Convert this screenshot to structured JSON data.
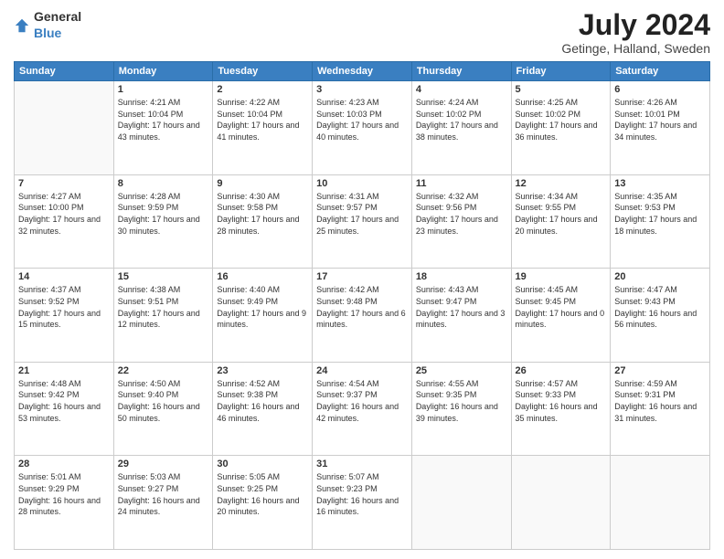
{
  "header": {
    "logo_general": "General",
    "logo_blue": "Blue",
    "month": "July 2024",
    "location": "Getinge, Halland, Sweden"
  },
  "days_of_week": [
    "Sunday",
    "Monday",
    "Tuesday",
    "Wednesday",
    "Thursday",
    "Friday",
    "Saturday"
  ],
  "weeks": [
    [
      {
        "day": "",
        "sunrise": "",
        "sunset": "",
        "daylight": ""
      },
      {
        "day": "1",
        "sunrise": "Sunrise: 4:21 AM",
        "sunset": "Sunset: 10:04 PM",
        "daylight": "Daylight: 17 hours and 43 minutes."
      },
      {
        "day": "2",
        "sunrise": "Sunrise: 4:22 AM",
        "sunset": "Sunset: 10:04 PM",
        "daylight": "Daylight: 17 hours and 41 minutes."
      },
      {
        "day": "3",
        "sunrise": "Sunrise: 4:23 AM",
        "sunset": "Sunset: 10:03 PM",
        "daylight": "Daylight: 17 hours and 40 minutes."
      },
      {
        "day": "4",
        "sunrise": "Sunrise: 4:24 AM",
        "sunset": "Sunset: 10:02 PM",
        "daylight": "Daylight: 17 hours and 38 minutes."
      },
      {
        "day": "5",
        "sunrise": "Sunrise: 4:25 AM",
        "sunset": "Sunset: 10:02 PM",
        "daylight": "Daylight: 17 hours and 36 minutes."
      },
      {
        "day": "6",
        "sunrise": "Sunrise: 4:26 AM",
        "sunset": "Sunset: 10:01 PM",
        "daylight": "Daylight: 17 hours and 34 minutes."
      }
    ],
    [
      {
        "day": "7",
        "sunrise": "Sunrise: 4:27 AM",
        "sunset": "Sunset: 10:00 PM",
        "daylight": "Daylight: 17 hours and 32 minutes."
      },
      {
        "day": "8",
        "sunrise": "Sunrise: 4:28 AM",
        "sunset": "Sunset: 9:59 PM",
        "daylight": "Daylight: 17 hours and 30 minutes."
      },
      {
        "day": "9",
        "sunrise": "Sunrise: 4:30 AM",
        "sunset": "Sunset: 9:58 PM",
        "daylight": "Daylight: 17 hours and 28 minutes."
      },
      {
        "day": "10",
        "sunrise": "Sunrise: 4:31 AM",
        "sunset": "Sunset: 9:57 PM",
        "daylight": "Daylight: 17 hours and 25 minutes."
      },
      {
        "day": "11",
        "sunrise": "Sunrise: 4:32 AM",
        "sunset": "Sunset: 9:56 PM",
        "daylight": "Daylight: 17 hours and 23 minutes."
      },
      {
        "day": "12",
        "sunrise": "Sunrise: 4:34 AM",
        "sunset": "Sunset: 9:55 PM",
        "daylight": "Daylight: 17 hours and 20 minutes."
      },
      {
        "day": "13",
        "sunrise": "Sunrise: 4:35 AM",
        "sunset": "Sunset: 9:53 PM",
        "daylight": "Daylight: 17 hours and 18 minutes."
      }
    ],
    [
      {
        "day": "14",
        "sunrise": "Sunrise: 4:37 AM",
        "sunset": "Sunset: 9:52 PM",
        "daylight": "Daylight: 17 hours and 15 minutes."
      },
      {
        "day": "15",
        "sunrise": "Sunrise: 4:38 AM",
        "sunset": "Sunset: 9:51 PM",
        "daylight": "Daylight: 17 hours and 12 minutes."
      },
      {
        "day": "16",
        "sunrise": "Sunrise: 4:40 AM",
        "sunset": "Sunset: 9:49 PM",
        "daylight": "Daylight: 17 hours and 9 minutes."
      },
      {
        "day": "17",
        "sunrise": "Sunrise: 4:42 AM",
        "sunset": "Sunset: 9:48 PM",
        "daylight": "Daylight: 17 hours and 6 minutes."
      },
      {
        "day": "18",
        "sunrise": "Sunrise: 4:43 AM",
        "sunset": "Sunset: 9:47 PM",
        "daylight": "Daylight: 17 hours and 3 minutes."
      },
      {
        "day": "19",
        "sunrise": "Sunrise: 4:45 AM",
        "sunset": "Sunset: 9:45 PM",
        "daylight": "Daylight: 17 hours and 0 minutes."
      },
      {
        "day": "20",
        "sunrise": "Sunrise: 4:47 AM",
        "sunset": "Sunset: 9:43 PM",
        "daylight": "Daylight: 16 hours and 56 minutes."
      }
    ],
    [
      {
        "day": "21",
        "sunrise": "Sunrise: 4:48 AM",
        "sunset": "Sunset: 9:42 PM",
        "daylight": "Daylight: 16 hours and 53 minutes."
      },
      {
        "day": "22",
        "sunrise": "Sunrise: 4:50 AM",
        "sunset": "Sunset: 9:40 PM",
        "daylight": "Daylight: 16 hours and 50 minutes."
      },
      {
        "day": "23",
        "sunrise": "Sunrise: 4:52 AM",
        "sunset": "Sunset: 9:38 PM",
        "daylight": "Daylight: 16 hours and 46 minutes."
      },
      {
        "day": "24",
        "sunrise": "Sunrise: 4:54 AM",
        "sunset": "Sunset: 9:37 PM",
        "daylight": "Daylight: 16 hours and 42 minutes."
      },
      {
        "day": "25",
        "sunrise": "Sunrise: 4:55 AM",
        "sunset": "Sunset: 9:35 PM",
        "daylight": "Daylight: 16 hours and 39 minutes."
      },
      {
        "day": "26",
        "sunrise": "Sunrise: 4:57 AM",
        "sunset": "Sunset: 9:33 PM",
        "daylight": "Daylight: 16 hours and 35 minutes."
      },
      {
        "day": "27",
        "sunrise": "Sunrise: 4:59 AM",
        "sunset": "Sunset: 9:31 PM",
        "daylight": "Daylight: 16 hours and 31 minutes."
      }
    ],
    [
      {
        "day": "28",
        "sunrise": "Sunrise: 5:01 AM",
        "sunset": "Sunset: 9:29 PM",
        "daylight": "Daylight: 16 hours and 28 minutes."
      },
      {
        "day": "29",
        "sunrise": "Sunrise: 5:03 AM",
        "sunset": "Sunset: 9:27 PM",
        "daylight": "Daylight: 16 hours and 24 minutes."
      },
      {
        "day": "30",
        "sunrise": "Sunrise: 5:05 AM",
        "sunset": "Sunset: 9:25 PM",
        "daylight": "Daylight: 16 hours and 20 minutes."
      },
      {
        "day": "31",
        "sunrise": "Sunrise: 5:07 AM",
        "sunset": "Sunset: 9:23 PM",
        "daylight": "Daylight: 16 hours and 16 minutes."
      },
      {
        "day": "",
        "sunrise": "",
        "sunset": "",
        "daylight": ""
      },
      {
        "day": "",
        "sunrise": "",
        "sunset": "",
        "daylight": ""
      },
      {
        "day": "",
        "sunrise": "",
        "sunset": "",
        "daylight": ""
      }
    ]
  ]
}
